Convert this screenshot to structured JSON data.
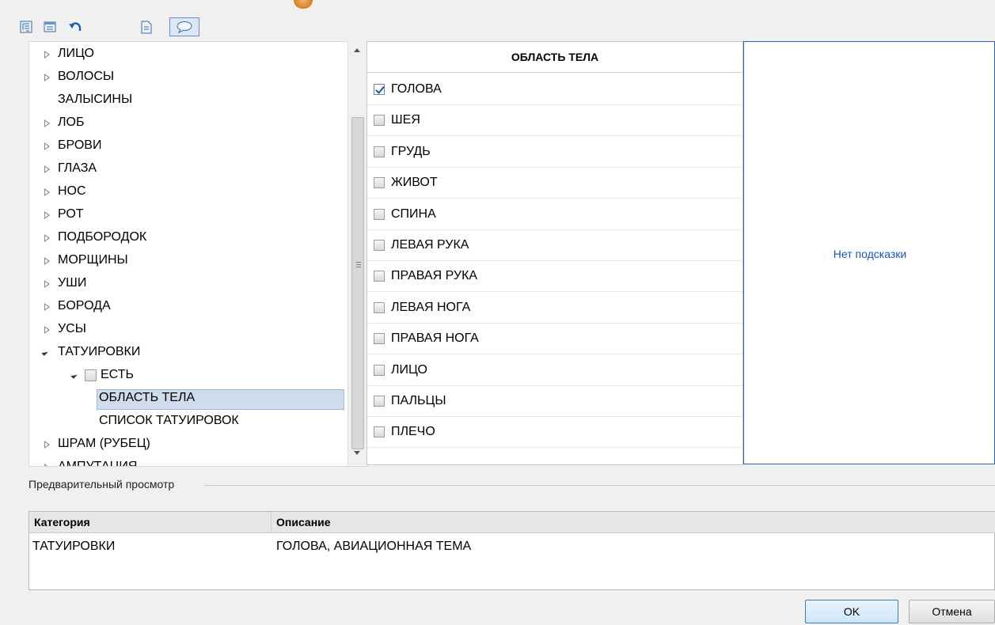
{
  "toolbar": {
    "buttons": [
      {
        "icon": "tree-view-icon"
      },
      {
        "icon": "list-view-icon"
      },
      {
        "icon": "undo-icon"
      },
      {
        "icon": "document-icon"
      },
      {
        "icon": "comment-icon",
        "active": true
      }
    ]
  },
  "tree": {
    "items": [
      {
        "label": "ЛИЦО",
        "arrow": "closed",
        "level": 0
      },
      {
        "label": "ВОЛОСЫ",
        "arrow": "closed",
        "level": 0
      },
      {
        "label": "ЗАЛЫСИНЫ",
        "arrow": "none",
        "level": 0
      },
      {
        "label": "ЛОБ",
        "arrow": "closed",
        "level": 0
      },
      {
        "label": "БРОВИ",
        "arrow": "closed",
        "level": 0
      },
      {
        "label": "ГЛАЗА",
        "arrow": "closed",
        "level": 0
      },
      {
        "label": "НОС",
        "arrow": "closed",
        "level": 0
      },
      {
        "label": "РОТ",
        "arrow": "closed",
        "level": 0
      },
      {
        "label": "ПОДБОРОДОК",
        "arrow": "closed",
        "level": 0
      },
      {
        "label": "МОРЩИНЫ",
        "arrow": "closed",
        "level": 0
      },
      {
        "label": "УШИ",
        "arrow": "closed",
        "level": 0
      },
      {
        "label": "БОРОДА",
        "arrow": "closed",
        "level": 0
      },
      {
        "label": "УСЫ",
        "arrow": "closed",
        "level": 0
      },
      {
        "label": "ТАТУИРОВКИ",
        "arrow": "open",
        "level": 0
      },
      {
        "label": "ЕСТЬ",
        "arrow": "open",
        "level": 1,
        "checkbox": true
      },
      {
        "label": "ОБЛАСТЬ ТЕЛА",
        "arrow": "none",
        "level": 2,
        "selected": true
      },
      {
        "label": "СПИСОК ТАТУИРОВОК",
        "arrow": "none",
        "level": 2
      },
      {
        "label": "ШРАМ (РУБЕЦ)",
        "arrow": "closed",
        "level": 0
      },
      {
        "label": "АМПУТАЦИЯ",
        "arrow": "closed",
        "level": 0
      }
    ]
  },
  "body_area": {
    "header": "ОБЛАСТЬ ТЕЛА",
    "options": [
      {
        "label": "ГОЛОВА",
        "checked": true
      },
      {
        "label": "ШЕЯ",
        "checked": false
      },
      {
        "label": "ГРУДЬ",
        "checked": false
      },
      {
        "label": "ЖИВОТ",
        "checked": false
      },
      {
        "label": "СПИНА",
        "checked": false
      },
      {
        "label": "ЛЕВАЯ РУКА",
        "checked": false
      },
      {
        "label": "ПРАВАЯ РУКА",
        "checked": false
      },
      {
        "label": "ЛЕВАЯ НОГА",
        "checked": false
      },
      {
        "label": "ПРАВАЯ НОГА",
        "checked": false
      },
      {
        "label": "ЛИЦО",
        "checked": false
      },
      {
        "label": "ПАЛЬЦЫ",
        "checked": false
      },
      {
        "label": "ПЛЕЧО",
        "checked": false
      }
    ]
  },
  "hint": {
    "text": "Нет подсказки"
  },
  "preview": {
    "label": "Предварительный просмотр",
    "columns": [
      "Категория",
      "Описание"
    ],
    "rows": [
      {
        "category": "ТАТУИРОВКИ",
        "description": "ГОЛОВА, АВИАЦИОННАЯ ТЕМА"
      }
    ]
  },
  "buttons": {
    "ok": "OK",
    "cancel": "Отмена"
  },
  "colors": {
    "accent": "#2a64b0",
    "hint_text": "#1a56a8",
    "selection": "#cfdcec"
  }
}
